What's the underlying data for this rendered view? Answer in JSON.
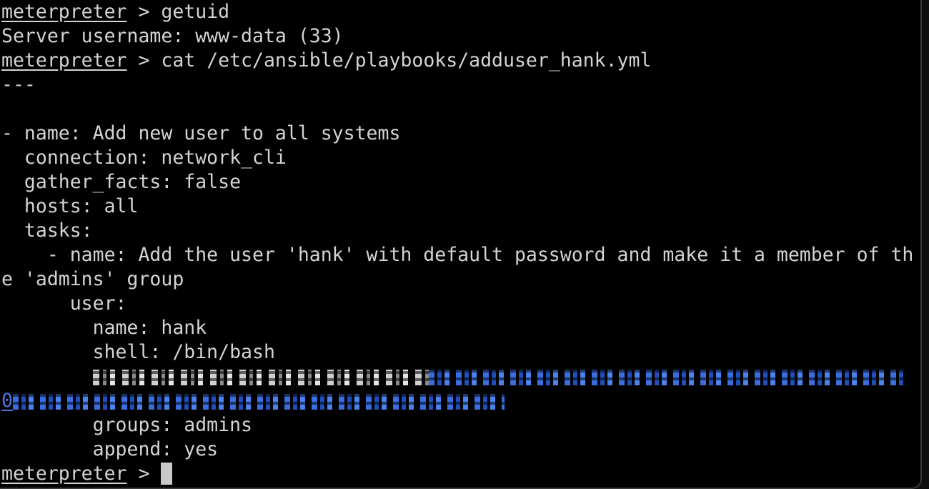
{
  "terminal": {
    "prompt": "meterpreter",
    "prompt_suffix": " > ",
    "lines": {
      "cmd1": "getuid",
      "out1": "Server username: www-data (33)",
      "cmd2": "cat /etc/ansible/playbooks/adduser_hank.yml",
      "l_sep": "---",
      "l_blank": "",
      "l_name": "- name: Add new user to all systems",
      "l_connection": "  connection: network_cli",
      "l_gather": "  gather_facts: false",
      "l_hosts": "  hosts: all",
      "l_tasks": "  tasks:",
      "l_task_name_a": "    - name: Add the user 'hank' with default password and make it a member of th",
      "l_task_name_b": "e 'admins' group",
      "l_user": "      user:",
      "l_user_name": "        name: hank",
      "l_shell": "        shell: /bin/bash",
      "l_redacted_indent": "        ",
      "l_wrap_zero": "0",
      "l_groups": "        groups: admins",
      "l_append": "        append: yes"
    }
  },
  "colors": {
    "background": "#000000",
    "text": "#d3d3d3",
    "link": "#4a74e0",
    "redaction_blue": "#3a6ee0",
    "cursor": "#c8c8c8"
  }
}
